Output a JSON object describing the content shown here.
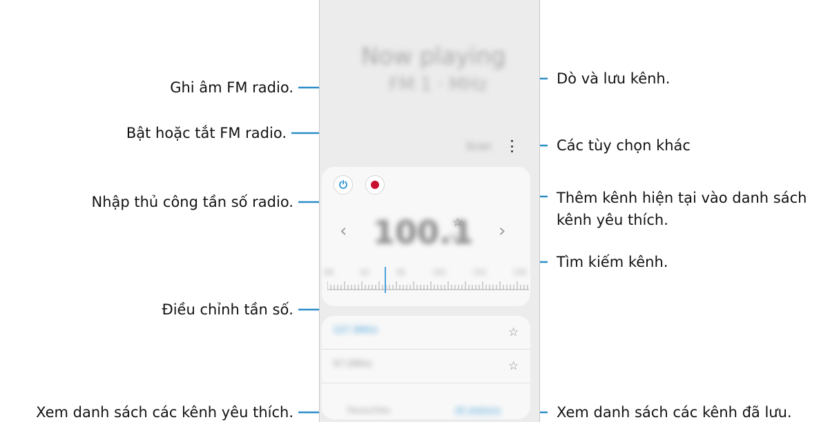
{
  "annotations": {
    "record": "Ghi âm FM radio.",
    "power": "Bật hoặc tắt FM radio.",
    "manual_freq": "Nhập thủ công tần số radio.",
    "adjust_freq": "Điều chỉnh tần số.",
    "favorites_list": "Xem danh sách các kênh yêu thích.",
    "scan_save": "Dò và lưu kênh.",
    "more_options": "Các tùy chọn khác",
    "add_favorite": "Thêm kênh hiện tại vào danh sách kênh yêu thích.",
    "search_channel": "Tìm kiếm kênh.",
    "saved_list": "Xem danh sách các kênh đã lưu."
  },
  "phone": {
    "header_title": "Now playing",
    "header_sub": "FM 1 · MHz",
    "scan_label": "Scan",
    "more_icon": "more-vertical-icon",
    "power_icon": "power-icon",
    "record_icon": "record-icon",
    "frequency": "100.1",
    "unit": "MHz",
    "scale_ticks": [
      "88",
      "92",
      "96",
      "100",
      "104",
      "108"
    ],
    "channels": [
      {
        "name": "107.9MHz",
        "color": "#4aa3d8"
      },
      {
        "name": "97.0MHz",
        "color": "#9a9a9a"
      }
    ],
    "tab_favorites": "Favourites",
    "tab_all": "All stations",
    "accent": "#1a8fd0",
    "record_color": "#c8102e"
  }
}
